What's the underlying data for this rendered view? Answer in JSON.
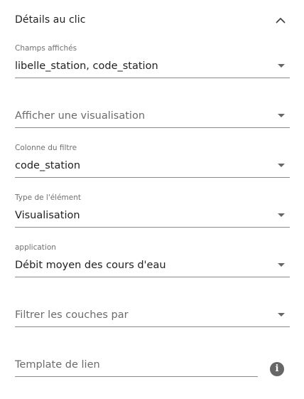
{
  "section": {
    "title": "Détails au clic",
    "collapse_icon": "chevron-up-icon"
  },
  "fields": {
    "champs_affiches": {
      "label": "Champs affichés",
      "value": "libelle_station,  code_station"
    },
    "afficher_visualisation": {
      "placeholder": "Afficher une visualisation"
    },
    "colonne_filtre": {
      "label": "Colonne du filtre",
      "value": "code_station"
    },
    "type_element": {
      "label": "Type de l'élément",
      "value": "Visualisation"
    },
    "application": {
      "label": "application",
      "value": "Débit moyen des cours d'eau"
    },
    "filtrer_couches": {
      "placeholder": "Filtrer les couches par"
    },
    "template_lien": {
      "placeholder": "Template de lien"
    }
  },
  "icons": {
    "dropdown": "caret-down-icon",
    "info": "info-icon",
    "info_glyph": "i"
  },
  "colors": {
    "text": "#212121",
    "label": "#707070",
    "underline": "#8a8a8a",
    "icon": "#666666"
  }
}
